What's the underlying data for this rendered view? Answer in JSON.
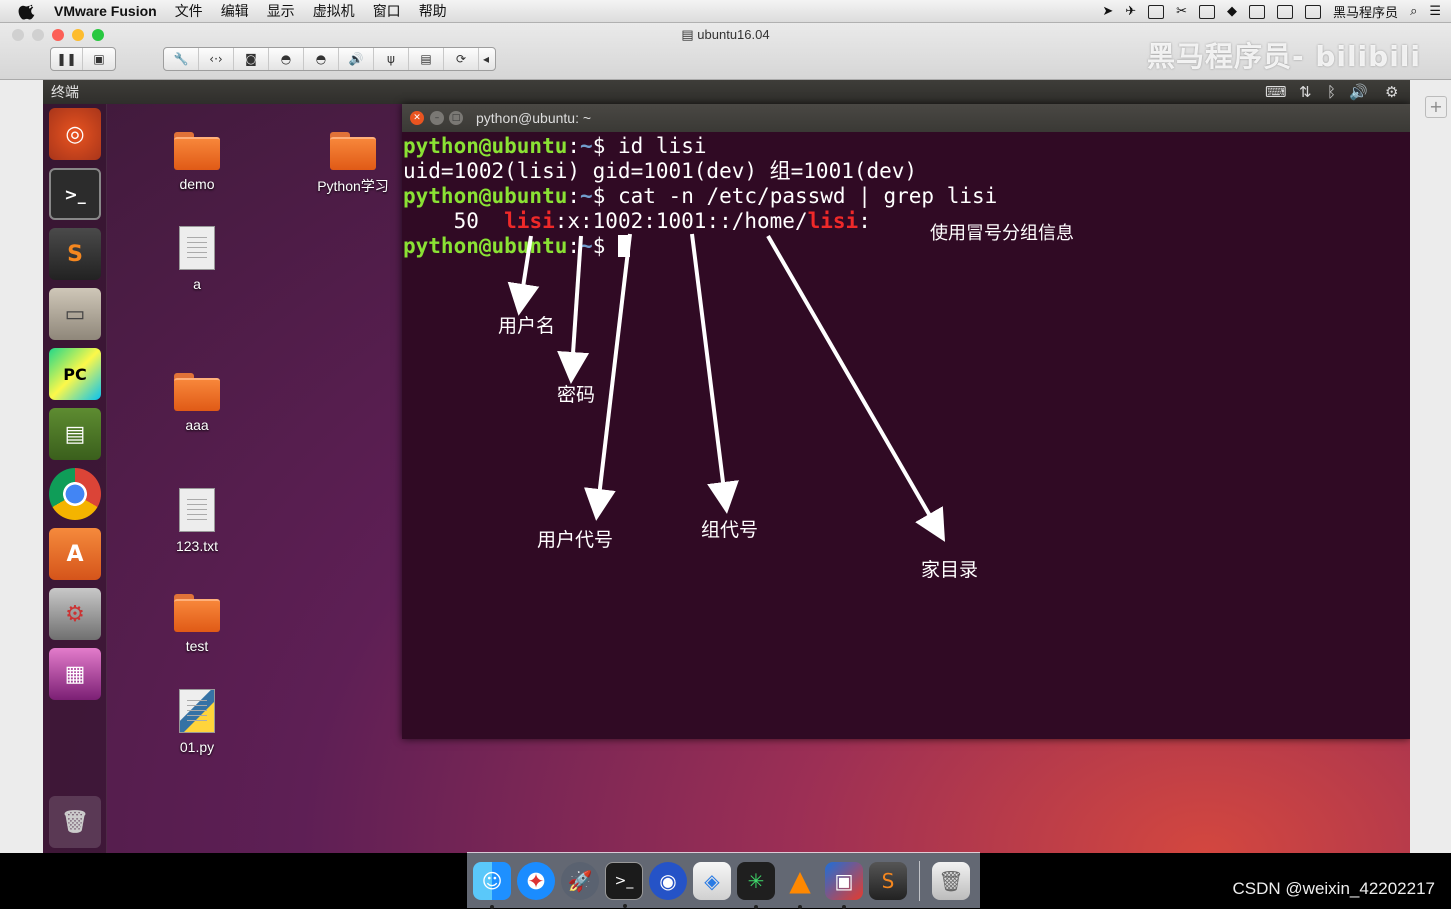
{
  "mac_menubar": {
    "app_name": "VMware Fusion",
    "menus": [
      "文件",
      "编辑",
      "显示",
      "虚拟机",
      "窗口",
      "帮助"
    ],
    "status_text": "黑马程序员"
  },
  "vmware": {
    "window_title": "ubuntu16.04",
    "watermark": "黑马程序员- bilibili"
  },
  "ubuntu": {
    "topbar_title": "终端",
    "desktop_icons": [
      "demo",
      "Python学习",
      "a",
      "aaa",
      "123.txt",
      "test",
      "01.py"
    ]
  },
  "terminal": {
    "title": "python@ubuntu: ~",
    "prompt_user": "python@ubuntu",
    "prompt_sep": ":",
    "prompt_path": "~",
    "prompt_end": "$ ",
    "cmd1": "id lisi",
    "output1": "uid=1002(lisi) gid=1001(dev) 组=1001(dev)",
    "cmd2": "cat -n /etc/passwd | grep lisi",
    "line_no": "    50  ",
    "field_user": "lisi",
    "field_mid": ":x:1002:1001::/home/",
    "field_home_user": "lisi",
    "field_end": ":"
  },
  "annotations": {
    "colon_note": "使用冒号分组信息",
    "username": "用户名",
    "password": "密码",
    "uid": "用户代号",
    "gid": "组代号",
    "home": "家目录"
  },
  "footer": {
    "credit": "CSDN @weixin_42202217"
  },
  "colors": {
    "terminal_bg": "#300a24",
    "prompt_green": "#8ae234",
    "prompt_blue": "#729fcf",
    "grep_red": "#ef2929"
  }
}
